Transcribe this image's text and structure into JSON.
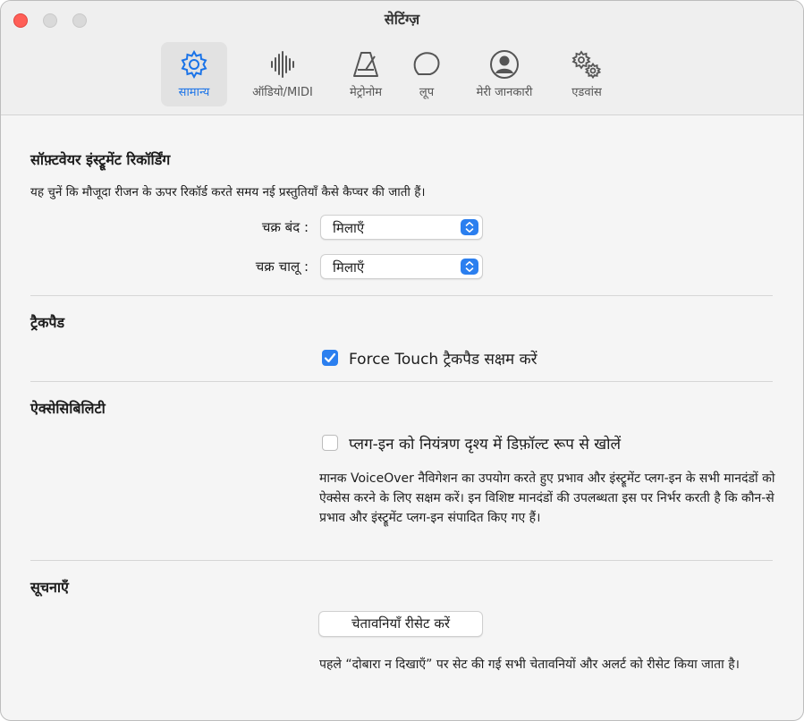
{
  "window": {
    "title": "सेटिंग्ज़"
  },
  "tabs": [
    {
      "label": "सामान्य",
      "icon": "gear-icon",
      "active": true
    },
    {
      "label": "ऑडियो/MIDI",
      "icon": "waveform-icon",
      "active": false
    },
    {
      "label": "मेट्रोनोम",
      "icon": "metronome-icon",
      "active": false
    },
    {
      "label": "लूप",
      "icon": "loop-icon",
      "active": false
    },
    {
      "label": "मेरी जानकारी",
      "icon": "person-circle-icon",
      "active": false
    },
    {
      "label": "एडवांस",
      "icon": "gears-icon",
      "active": false
    }
  ],
  "software_recording": {
    "heading": "सॉफ़्टवेयर इंस्ट्रूमेंट रिकॉर्डिंग",
    "description": "यह चुनें कि मौजूदा रीजन के ऊपर रिकॉर्ड करते समय नई प्रस्तुतियाँ कैसे कैप्चर की जाती हैं।",
    "cycle_off_label": "चक्र बंद :",
    "cycle_off_value": "मिलाएँ",
    "cycle_on_label": "चक्र चालू :",
    "cycle_on_value": "मिलाएँ"
  },
  "trackpad": {
    "heading": "ट्रैकपैड",
    "force_touch_label": "Force Touch ट्रैकपैड सक्षम करें",
    "force_touch_checked": true
  },
  "accessibility": {
    "heading": "ऐक्सेसिबिलिटी",
    "plugin_label": "प्लग-इन को नियंत्रण दृश्य में डिफ़ॉल्ट रूप से खोलें",
    "plugin_checked": false,
    "description": "मानक VoiceOver नैविगेशन का उपयोग करते हुए प्रभाव और इंस्ट्रूमेंट प्लग-इन के सभी मानदंडों को ऐक्सेस करने के लिए सक्षम करें। इन विशिष्ट मानदंडों की उपलब्धता इस पर निर्भर करती है कि कौन-से प्रभाव और इंस्ट्रूमेंट प्लग-इन संपादित किए गए हैं।"
  },
  "notifications": {
    "heading": "सूचनाएँ",
    "reset_button": "चेतावनियाँ रीसेट करें",
    "description": "पहले “दोबारा न दिखाएँ” पर सेट की गई सभी चेतावनियों और अलर्ट को रीसेट किया जाता है।"
  },
  "colors": {
    "accent": "#2b7fef",
    "close": "#ff5f57"
  }
}
